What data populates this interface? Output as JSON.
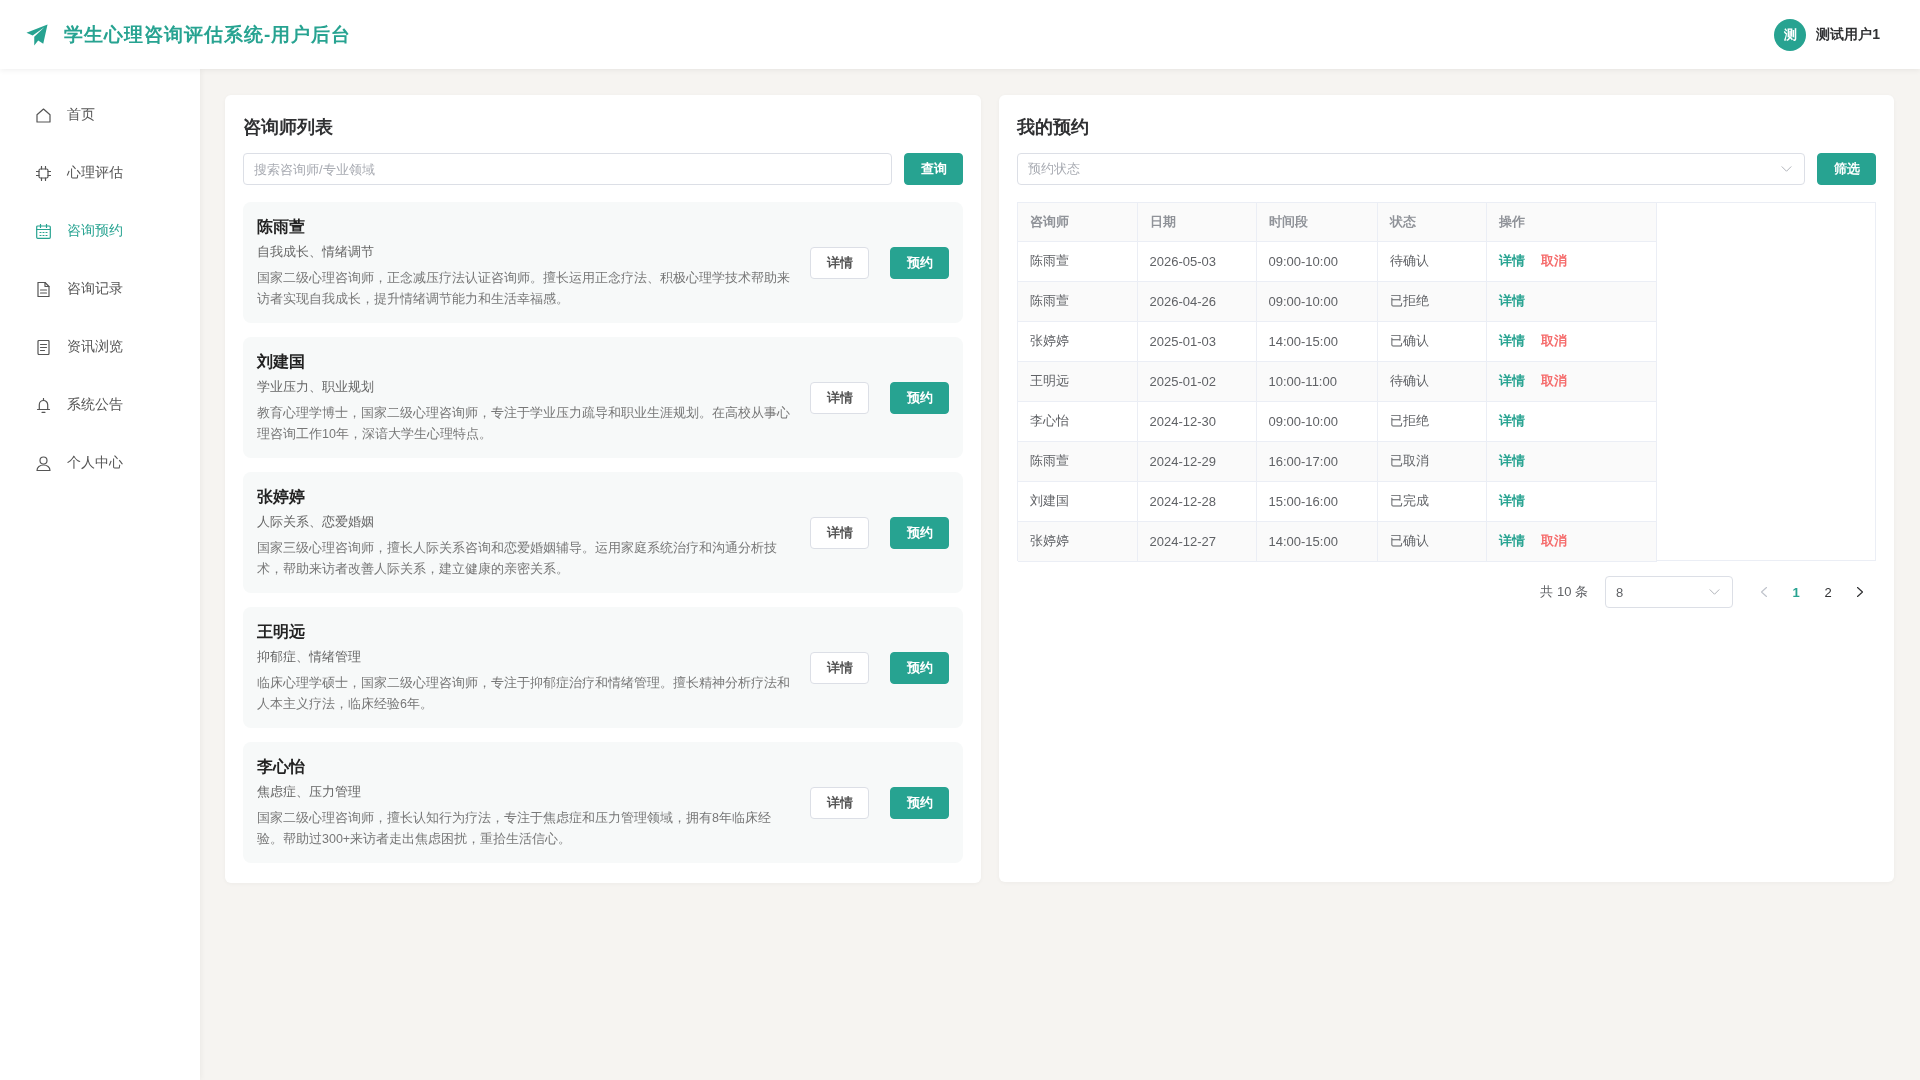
{
  "header": {
    "title": "学生心理咨询评估系统-用户后台",
    "user": {
      "avatar_text": "测",
      "name": "测试用户1"
    }
  },
  "sidebar": {
    "items": [
      {
        "label": "首页",
        "selected": false
      },
      {
        "label": "心理评估",
        "selected": false
      },
      {
        "label": "咨询预约",
        "selected": true
      },
      {
        "label": "咨询记录",
        "selected": false
      },
      {
        "label": "资讯浏览",
        "selected": false
      },
      {
        "label": "系统公告",
        "selected": false
      },
      {
        "label": "个人中心",
        "selected": false
      }
    ]
  },
  "counselors": {
    "title": "咨询师列表",
    "search": {
      "placeholder": "搜索咨询师/专业领域"
    },
    "search_button": "查询",
    "items": [
      {
        "name": "陈雨萱",
        "specialties": "自我成长、情绪调节",
        "bio": "国家二级心理咨询师，正念减压疗法认证咨询师。擅长运用正念疗法、积极心理学技术帮助来访者实现自我成长，提升情绪调节能力和生活幸福感。",
        "detail_button": "详情",
        "book_button": "预约"
      },
      {
        "name": "刘建国",
        "specialties": "学业压力、职业规划",
        "bio": "教育心理学博士，国家二级心理咨询师，专注于学业压力疏导和职业生涯规划。在高校从事心理咨询工作10年，深谙大学生心理特点。",
        "detail_button": "详情",
        "book_button": "预约"
      },
      {
        "name": "张婷婷",
        "specialties": "人际关系、恋爱婚姻",
        "bio": "国家三级心理咨询师，擅长人际关系咨询和恋爱婚姻辅导。运用家庭系统治疗和沟通分析技术，帮助来访者改善人际关系，建立健康的亲密关系。",
        "detail_button": "详情",
        "book_button": "预约"
      },
      {
        "name": "王明远",
        "specialties": "抑郁症、情绪管理",
        "bio": "临床心理学硕士，国家二级心理咨询师，专注于抑郁症治疗和情绪管理。擅长精神分析疗法和人本主义疗法，临床经验6年。",
        "detail_button": "详情",
        "book_button": "预约"
      },
      {
        "name": "李心怡",
        "specialties": "焦虑症、压力管理",
        "bio": "国家二级心理咨询师，擅长认知行为疗法，专注于焦虑症和压力管理领域，拥有8年临床经验。帮助过300+来访者走出焦虑困扰，重拾生活信心。",
        "detail_button": "详情",
        "book_button": "预约"
      }
    ]
  },
  "appointments": {
    "title": "我的预约",
    "status_filter": {
      "placeholder": "预约状态"
    },
    "filter_button": "筛选",
    "table": {
      "columns": [
        "咨询师",
        "日期",
        "时间段",
        "状态",
        "操作"
      ],
      "rows": [
        {
          "counselor": "陈雨萱",
          "date": "2026-05-03",
          "time": "09:00-10:00",
          "status": "待确认",
          "actions": [
            {
              "label": "详情",
              "kind": "detail"
            },
            {
              "label": "取消",
              "kind": "cancel"
            }
          ]
        },
        {
          "counselor": "陈雨萱",
          "date": "2026-04-26",
          "time": "09:00-10:00",
          "status": "已拒绝",
          "actions": [
            {
              "label": "详情",
              "kind": "detail"
            }
          ]
        },
        {
          "counselor": "张婷婷",
          "date": "2025-01-03",
          "time": "14:00-15:00",
          "status": "已确认",
          "actions": [
            {
              "label": "详情",
              "kind": "detail"
            },
            {
              "label": "取消",
              "kind": "cancel"
            }
          ]
        },
        {
          "counselor": "王明远",
          "date": "2025-01-02",
          "time": "10:00-11:00",
          "status": "待确认",
          "actions": [
            {
              "label": "详情",
              "kind": "detail"
            },
            {
              "label": "取消",
              "kind": "cancel"
            }
          ]
        },
        {
          "counselor": "李心怡",
          "date": "2024-12-30",
          "time": "09:00-10:00",
          "status": "已拒绝",
          "actions": [
            {
              "label": "详情",
              "kind": "detail"
            }
          ]
        },
        {
          "counselor": "陈雨萱",
          "date": "2024-12-29",
          "time": "16:00-17:00",
          "status": "已取消",
          "actions": [
            {
              "label": "详情",
              "kind": "detail"
            }
          ]
        },
        {
          "counselor": "刘建国",
          "date": "2024-12-28",
          "time": "15:00-16:00",
          "status": "已完成",
          "actions": [
            {
              "label": "详情",
              "kind": "detail"
            }
          ]
        },
        {
          "counselor": "张婷婷",
          "date": "2024-12-27",
          "time": "14:00-15:00",
          "status": "已确认",
          "actions": [
            {
              "label": "详情",
              "kind": "detail"
            },
            {
              "label": "取消",
              "kind": "cancel"
            }
          ]
        }
      ]
    },
    "pagination": {
      "total": "共 10 条",
      "page_size": "8",
      "prev": {
        "disabled": true
      },
      "next": {
        "disabled": false
      },
      "pages": [
        {
          "label": "1",
          "selected": true
        },
        {
          "label": "2",
          "selected": false
        }
      ]
    }
  }
}
